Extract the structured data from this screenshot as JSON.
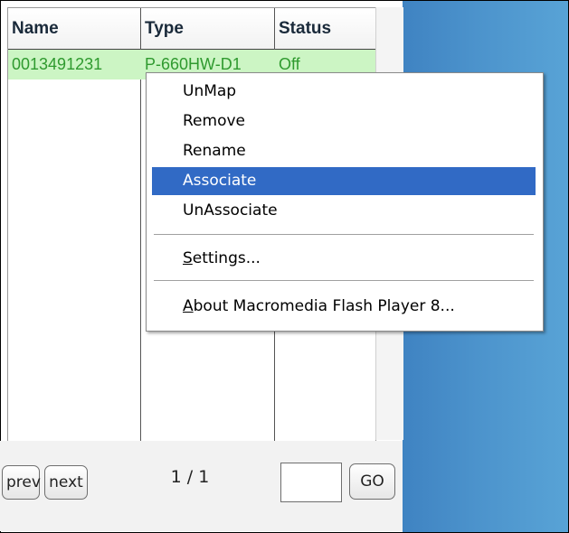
{
  "table": {
    "columns": [
      "Name",
      "Type",
      "Status"
    ],
    "rows": [
      {
        "name": "0013491231",
        "type": "P-660HW-D1",
        "status": "Off"
      }
    ]
  },
  "pager": {
    "prev_label": "prev",
    "next_label": "next",
    "page_info": "1 / 1",
    "page_input_value": "",
    "go_label": "GO"
  },
  "context_menu": {
    "items": [
      {
        "label": "UnMap",
        "highlighted": false
      },
      {
        "label": "Remove",
        "highlighted": false
      },
      {
        "label": "Rename",
        "highlighted": false
      },
      {
        "label": "Associate",
        "highlighted": true
      },
      {
        "label": "UnAssociate",
        "highlighted": false
      }
    ],
    "settings": {
      "accel": "S",
      "rest": "ettings..."
    },
    "about": {
      "accel": "A",
      "rest": "bout Macromedia Flash Player 8..."
    }
  },
  "colors": {
    "row_highlight": "#ccf5c4",
    "row_text": "#2f9a2f",
    "menu_selection": "#316ac5",
    "side_panel": "#4c93cc"
  }
}
